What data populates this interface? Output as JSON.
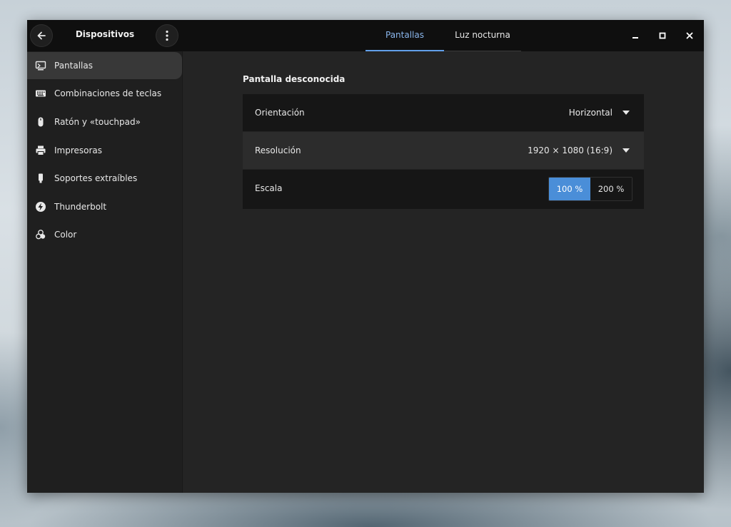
{
  "header": {
    "title": "Dispositivos",
    "tabs": [
      {
        "label": "Pantallas",
        "active": true
      },
      {
        "label": "Luz nocturna",
        "active": false
      }
    ]
  },
  "sidebar": {
    "items": [
      {
        "label": "Pantallas",
        "icon": "display-icon",
        "selected": true
      },
      {
        "label": "Combinaciones de teclas",
        "icon": "keyboard-icon"
      },
      {
        "label": "Ratón y «touchpad»",
        "icon": "mouse-icon"
      },
      {
        "label": "Impresoras",
        "icon": "printer-icon"
      },
      {
        "label": "Soportes extraíbles",
        "icon": "usb-drive-icon"
      },
      {
        "label": "Thunderbolt",
        "icon": "thunderbolt-icon"
      },
      {
        "label": "Color",
        "icon": "color-icon"
      }
    ]
  },
  "main": {
    "section_title": "Pantalla desconocida",
    "orientation": {
      "label": "Orientación",
      "value": "Horizontal"
    },
    "resolution": {
      "label": "Resolución",
      "value": "1920 × 1080 (16:9)"
    },
    "scale": {
      "label": "Escala",
      "options": [
        "100 %",
        "200 %"
      ],
      "selected": "100 %"
    }
  },
  "colors": {
    "accent": "#4a8ed8",
    "tab_active": "#62a0ea"
  }
}
